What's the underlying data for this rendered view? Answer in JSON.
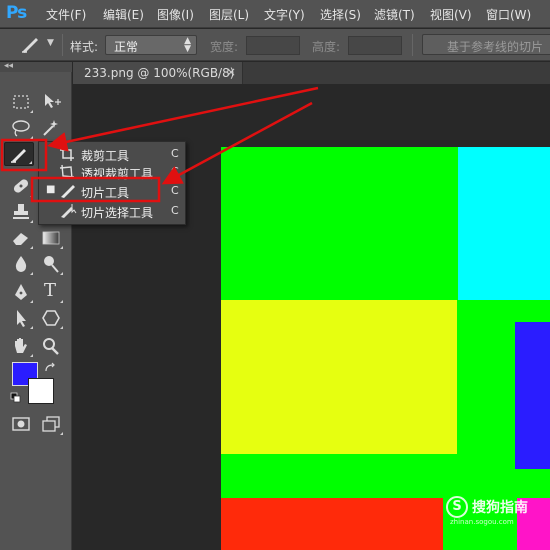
{
  "app": {
    "logo": "Ps"
  },
  "menu": [
    "文件(F)",
    "编辑(E)",
    "图像(I)",
    "图层(L)",
    "文字(Y)",
    "选择(S)",
    "滤镜(T)",
    "视图(V)",
    "窗口(W)"
  ],
  "options": {
    "style_label": "样式:",
    "style_value": "正常",
    "width_label": "宽度:",
    "height_label": "高度:",
    "guides_button": "基于参考线的切片"
  },
  "document": {
    "tab_title": "233.png @ 100%(RGB/8)",
    "close_glyph": "×"
  },
  "flyout": {
    "items": [
      {
        "label": "裁剪工具",
        "shortcut": "C",
        "selected": false,
        "icon": "crop-icon"
      },
      {
        "label": "透视裁剪工具",
        "shortcut": "C",
        "selected": false,
        "icon": "perspective-crop-icon"
      },
      {
        "label": "切片工具",
        "shortcut": "C",
        "selected": true,
        "icon": "slice-icon"
      },
      {
        "label": "切片选择工具",
        "shortcut": "C",
        "selected": false,
        "icon": "slice-select-icon"
      }
    ]
  },
  "tools": {
    "collapse_glyph": "◂◂",
    "text_tool_glyph": "T",
    "foreground_color": "#2a1dff",
    "background_color": "#ffffff"
  },
  "canvas": {
    "colors": {
      "green": "#00ff00",
      "cyan": "#00ffff",
      "yellow": "#e6ff10",
      "blue": "#2a1dff",
      "red": "#ff2a0a",
      "magenta": "#ff14c8"
    }
  },
  "watermark": {
    "symbol": "S",
    "text": "搜狗指南",
    "url": "zhinan.sogou.com"
  },
  "annotation_color": "#e01010"
}
